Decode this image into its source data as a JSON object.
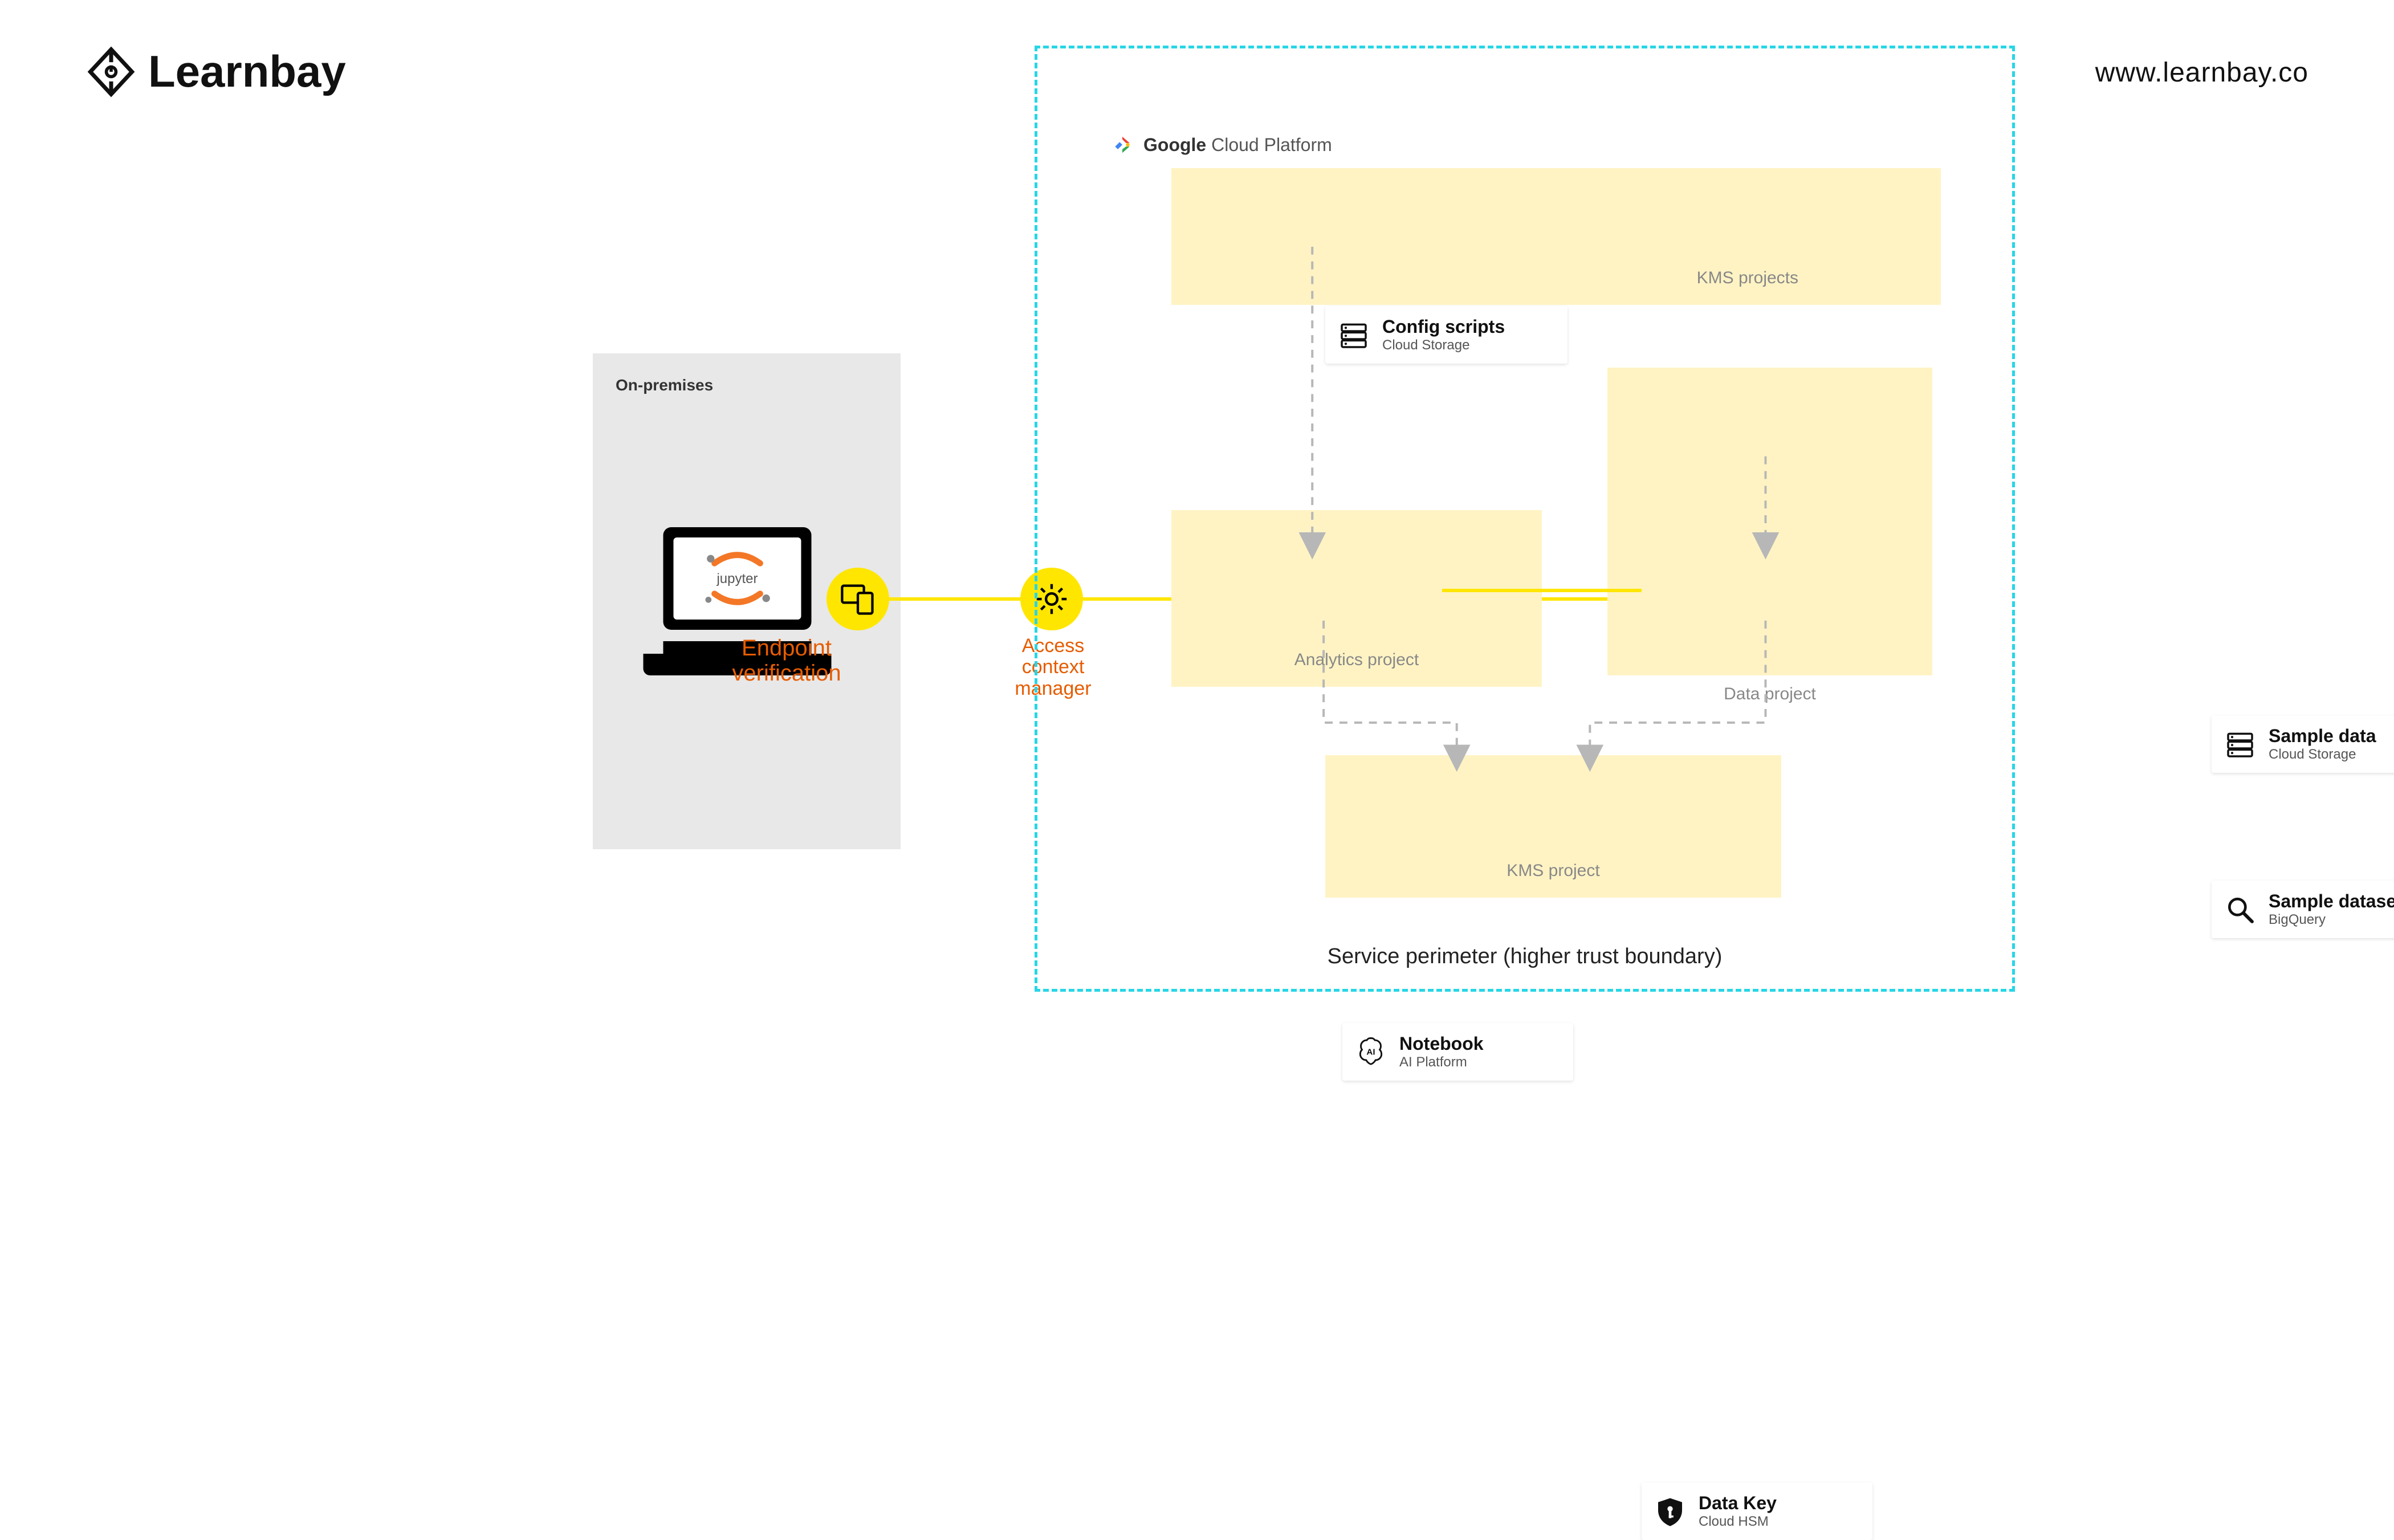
{
  "brand": {
    "name": "Learnbay",
    "url": "www.learnbay.co"
  },
  "onprem": {
    "label": "On-premises",
    "endpoint_label": "Endpoint\nverification",
    "jupyter": "jupyter"
  },
  "access_ctx": {
    "label": "Access\ncontext\nmanager"
  },
  "perimeter": {
    "caption": "Service perimeter (higher trust boundary)",
    "gcp_prefix": "Google",
    "gcp_rest": "Cloud Platform",
    "projects": {
      "kms_top": "KMS projects",
      "analytics": "Analytics project",
      "data": "Data project",
      "kms_bottom": "KMS project"
    },
    "cards": {
      "config": {
        "title": "Config scripts",
        "sub": "Cloud Storage"
      },
      "notebook": {
        "title": "Notebook",
        "sub": "AI Platform"
      },
      "sample": {
        "title": "Sample data",
        "sub": "Cloud Storage"
      },
      "dataset": {
        "title": "Sample dataset",
        "sub": "BigQuery"
      },
      "datakey": {
        "title": "Data Key",
        "sub": "Cloud HSM"
      }
    }
  }
}
